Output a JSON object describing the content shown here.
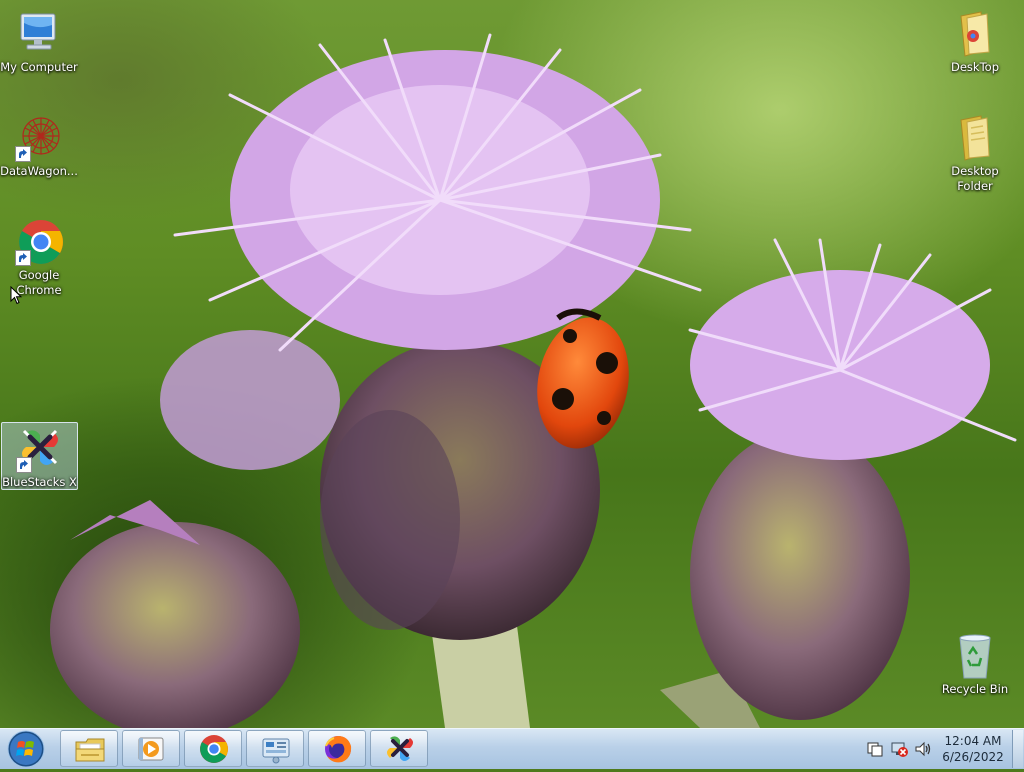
{
  "desktop": {
    "icons": [
      {
        "label": "My Computer",
        "icon": "computer-icon"
      },
      {
        "label": "DataWagon...",
        "icon": "datawagon-icon",
        "shortcut": true
      },
      {
        "label": "Google Chrome",
        "icon": "chrome-icon",
        "shortcut": true
      },
      {
        "label": "BlueStacks X",
        "icon": "bluestacks-icon",
        "shortcut": true,
        "selected": true
      },
      {
        "label": "DeskTop",
        "icon": "folder-icon"
      },
      {
        "label": "Desktop Folder",
        "icon": "folder-icon"
      },
      {
        "label": "Recycle Bin",
        "icon": "recycle-bin-icon"
      }
    ]
  },
  "taskbar": {
    "start": {
      "icon": "windows-start-icon"
    },
    "pinned": [
      {
        "icon": "file-explorer-icon"
      },
      {
        "icon": "media-player-icon"
      },
      {
        "icon": "chrome-icon"
      },
      {
        "icon": "control-panel-icon"
      },
      {
        "icon": "firefox-icon"
      },
      {
        "icon": "bluestacks-icon"
      }
    ],
    "tray": {
      "icons": [
        "action-center-icon",
        "network-disconnected-icon",
        "volume-icon"
      ],
      "time": "12:04 AM",
      "date": "6/26/2022"
    }
  },
  "colors": {
    "taskbar_top": "#d9e7f4",
    "taskbar_bottom": "#a7c3e0",
    "icon_label": "#ffffff",
    "selection": "#bed7f0"
  }
}
